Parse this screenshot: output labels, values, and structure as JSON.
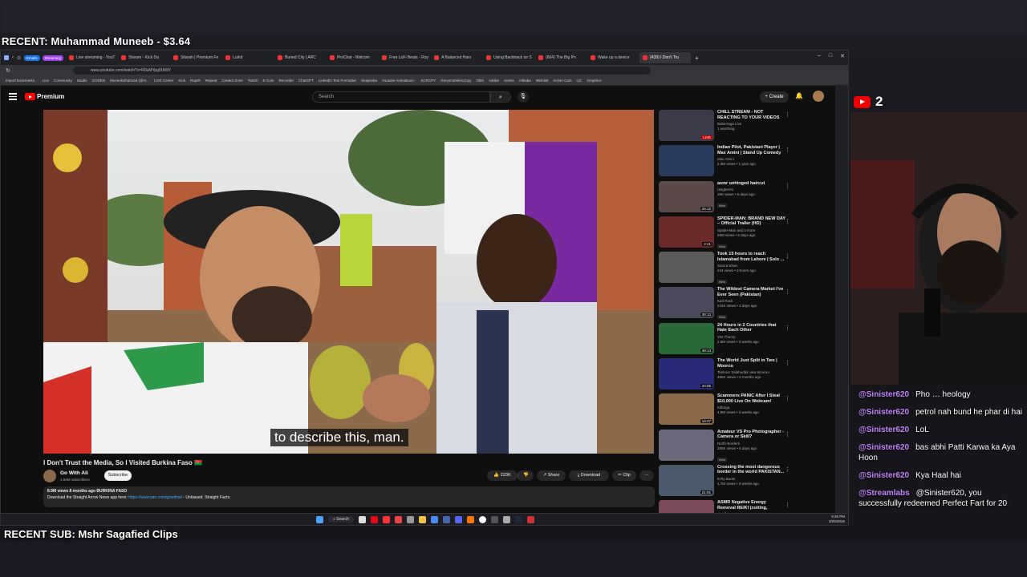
{
  "overlay": {
    "recent_donation": "RECENT: Muhammad Muneeb - $3.64",
    "recent_sub": "RECENT SUB: Mshr Sagafied Clips",
    "live_count": "2"
  },
  "browser": {
    "tabs": [
      {
        "label": "Live streaming - YouT",
        "active": false
      },
      {
        "label": "Stream - Kick Da",
        "active": false
      },
      {
        "label": "Sitarah | Premium Fe",
        "active": false
      },
      {
        "label": "Lurkit",
        "active": false
      },
      {
        "label": "Buried City | ARC",
        "active": false
      },
      {
        "label": "ProChat - Welcom",
        "active": false
      },
      {
        "label": "Free LoFi Beats - Roy",
        "active": false
      },
      {
        "label": "A Balanced Harv",
        "active": false
      },
      {
        "label": "Using Backtrack on S",
        "active": false
      },
      {
        "label": "(664) The Big Pn",
        "active": false
      },
      {
        "label": "Wake up a device",
        "active": false
      },
      {
        "label": "(439) I Don't Tru",
        "active": true
      }
    ],
    "pills": [
      "Emails",
      "Streaming"
    ],
    "url": "www.youtube.com/watch?v=R0uMYpg0Ub9Y",
    "bookmarks": [
      "Import bookmarks...",
      "Live",
      "Community",
      "Studio",
      "GODEN",
      "MuneebShahzad (@m...",
      "LIVE Center",
      "Kick",
      "RapIR",
      "Repeat",
      "Creator Zone",
      "Twitch",
      "E-Com",
      "Recorder",
      "ChatGPT",
      "LinkedIn Text Formatter",
      "Snapinsta",
      "Youtube Animations -",
      "SCRCPY",
      "Genymobile/scrcpy",
      "OBS",
      "Adobe",
      "Anime",
      "Alibaba",
      "Wishlist",
      "Action Cam",
      "c2c",
      "Graphics"
    ]
  },
  "youtube": {
    "logo_text": "Premium",
    "search_placeholder": "Search",
    "create_label": "Create",
    "caption": "to describe this, man.",
    "video_title": "I Don't Trust the Media, So I Visited Burkina Faso 🇧🇫",
    "channel_name": "Go With Ali",
    "channel_subs": "1.56M subscribers",
    "subscribe_label": "Subscribe",
    "like_count": "223K",
    "share_label": "Share",
    "download_label": "Download",
    "clip_label": "Clip",
    "desc_meta": "8.9M views  8 months ago  BURKINA FASO",
    "desc_text": "Download the Straight Arrow News app here:",
    "desc_link": "https://www.san.com/gowithali",
    "desc_tail": " - Unbiased. Straight Facts.",
    "related": [
      {
        "title": "CHILL STREAM - NOT REACTING TO YOUR VIDEOS -...",
        "channel": "BabaYaga Live",
        "meta": "1 watching",
        "duration": "LIVE",
        "thumb": "#3a3a48",
        "new": false
      },
      {
        "title": "Indian Pilot, Pakistani Player | Max Amini | Stand Up Comedy",
        "channel": "Max Amini",
        "meta": "2.3M views • 1 year ago",
        "duration": "",
        "thumb": "#2a3a5a",
        "new": false
      },
      {
        "title": "asmr unhinged haircut",
        "channel": "rasgbermi",
        "meta": "35K views • 6 days ago",
        "duration": "26:12",
        "thumb": "#5a4a4a",
        "new": true
      },
      {
        "title": "SPIDER-MAN: BRAND NEW DAY – Official Trailer (HD)",
        "channel": "Spider-Man and 3 more",
        "meta": "26M views • 5 days ago",
        "duration": "2:41",
        "thumb": "#6a2a2a",
        "new": true
      },
      {
        "title": "Took 15 hours to reach Islamabad from Lahore | Solo ...",
        "channel": "Samra Khan",
        "meta": "244 views • 3 hours ago",
        "duration": "",
        "thumb": "#5a5a58",
        "new": true
      },
      {
        "title": "The Wildest Camera Market I've Ever Seen (Pakistan)",
        "channel": "Karl Rock",
        "meta": "216K views • 3 days ago",
        "duration": "30:13",
        "thumb": "#4a4a5a",
        "new": true
      },
      {
        "title": "24 Hours in 2 Countries that Hate Each Other",
        "channel": "Yes Theory",
        "meta": "2.6M views • 3 weeks ago",
        "duration": "48:13",
        "thumb": "#2a6a3a",
        "new": false
      },
      {
        "title": "The World Just Split in Two | Moorco",
        "channel": "Taimoor Salahuddin aka Mooroo",
        "meta": "486K views • 2 months ago",
        "duration": "20:05",
        "thumb": "#2a2a7a",
        "new": false
      },
      {
        "title": "Scammers PANIC After I Steal $10,000 Live On Webcam!",
        "channel": "Kitboga",
        "meta": "4.9M views • 3 weeks ago",
        "duration": "14:47",
        "thumb": "#8a6a4a",
        "new": false
      },
      {
        "title": "Amateur VS Pro Photographer - Camera or Skill?",
        "channel": "North Borders",
        "meta": "295K views • 6 days ago",
        "duration": "",
        "thumb": "#6a6a7a",
        "new": true
      },
      {
        "title": "Crossing the most dangerous border in the world PAKISTAN...",
        "channel": "Itchy Boots",
        "meta": "1.7M views • 3 weeks ago",
        "duration": "21:01",
        "thumb": "#4a5a6a",
        "new": false
      },
      {
        "title": "ASMR Negative Energy Removal REIKI (cutting, humming, hand...",
        "channel": "danlife ASMR",
        "meta": "",
        "duration": "",
        "thumb": "#7a4a5a",
        "new": false
      }
    ]
  },
  "taskbar": {
    "search_label": "Search",
    "time": "9:26 PM",
    "date": "3/25/2026"
  },
  "chat": [
    {
      "user": "@Sinister620",
      "text": "Pho  …  heology"
    },
    {
      "user": "@Sinister620",
      "text": "petrol nah bund he phar di hai"
    },
    {
      "user": "@Sinister620",
      "text": "LoL"
    },
    {
      "user": "@Sinister620",
      "text": "bas abhi Patti Karwa ka Aya Hoon"
    },
    {
      "user": "@Sinister620",
      "text": "Kya Haal hai"
    },
    {
      "user": "@Streamlabs",
      "text": "@Sinister620, you successfully redeemed Perfect Fart for 20"
    }
  ]
}
